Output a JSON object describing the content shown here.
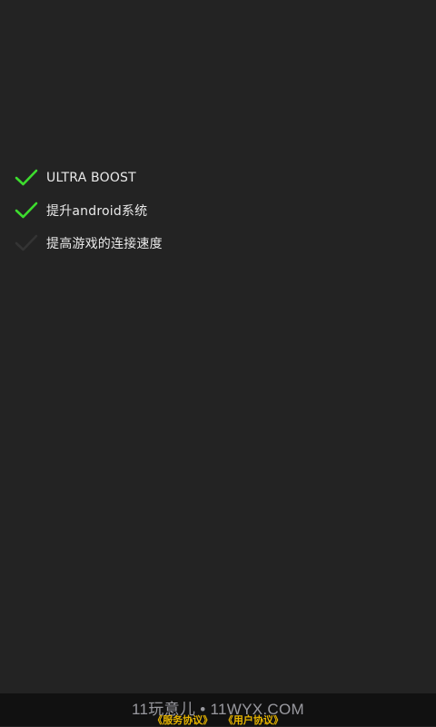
{
  "checklist": [
    {
      "label": "ULTRA BOOST",
      "checked": true,
      "icon": "check-icon"
    },
    {
      "label": "提升android系统",
      "checked": true,
      "icon": "check-icon"
    },
    {
      "label": "提高游戏的连接速度",
      "checked": false,
      "icon": "check-icon"
    }
  ],
  "colors": {
    "background": "#232323",
    "check_active": "#3ddc2e",
    "check_inactive": "#343434",
    "link": "#e6b400"
  },
  "footer": {
    "watermark": "11玩意儿 • 11WYX.COM",
    "service_agreement": "《服务协议》",
    "user_agreement": "《用户协议》"
  }
}
